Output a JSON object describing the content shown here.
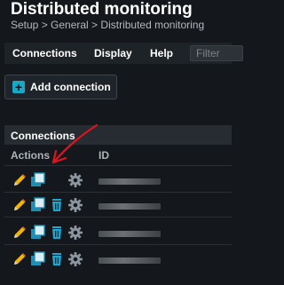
{
  "header": {
    "title": "Distributed monitoring",
    "breadcrumb": "Setup > General > Distributed monitoring"
  },
  "menubar": {
    "items": [
      "Connections",
      "Display",
      "Help"
    ],
    "filter_placeholder": "Filter"
  },
  "toolbar": {
    "add_connection_label": "Add connection"
  },
  "table": {
    "title": "Connections",
    "columns": [
      "Actions",
      "ID"
    ],
    "rows": [
      {
        "actions": [
          "edit-icon",
          "clone-icon",
          "settings-icon"
        ],
        "id": ""
      },
      {
        "actions": [
          "edit-icon",
          "clone-icon",
          "delete-icon",
          "settings-icon"
        ],
        "id": ""
      },
      {
        "actions": [
          "edit-icon",
          "clone-icon",
          "delete-icon",
          "settings-icon"
        ],
        "id": ""
      },
      {
        "actions": [
          "edit-icon",
          "clone-icon",
          "delete-icon",
          "settings-icon"
        ],
        "id": ""
      }
    ]
  },
  "colors": {
    "background": "#14181c",
    "accent": "#16a9c6",
    "annotation": "#e0141e"
  }
}
